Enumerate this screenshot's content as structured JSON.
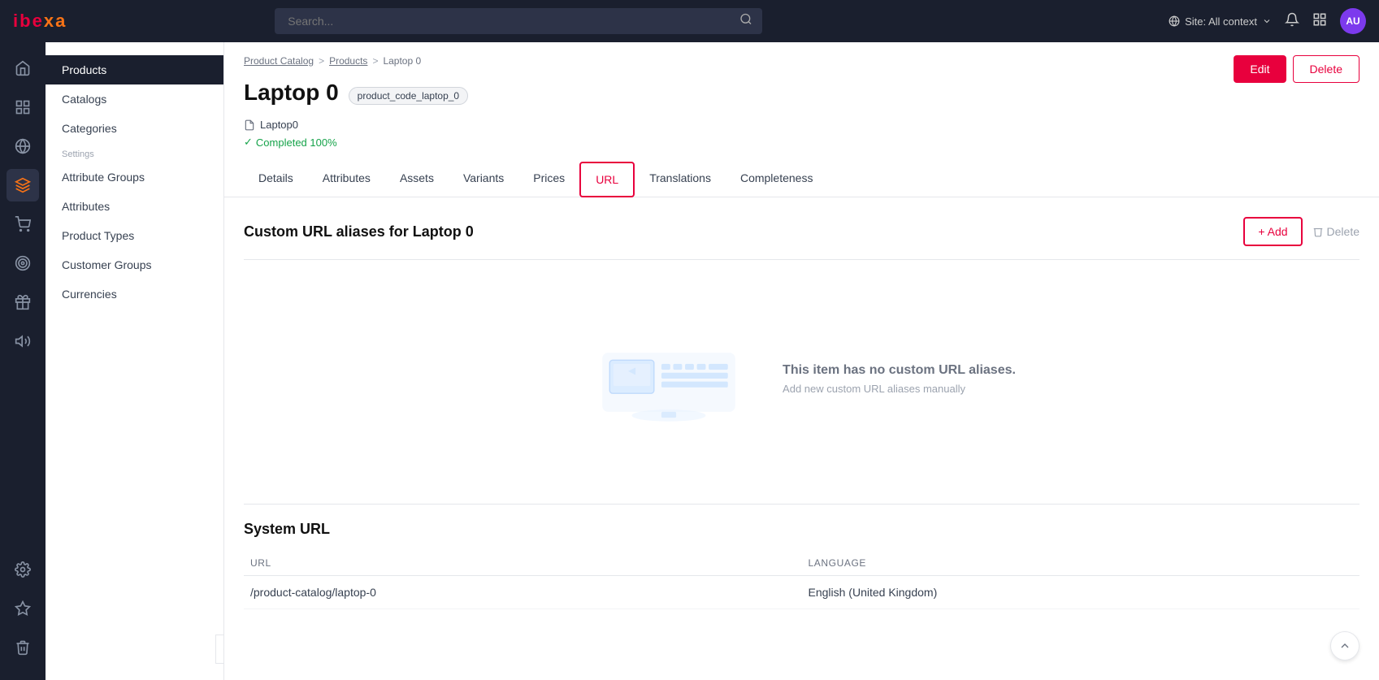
{
  "topbar": {
    "logo": "ibexa",
    "search_placeholder": "Search...",
    "site_context": "Site: All context",
    "avatar_initials": "AU"
  },
  "breadcrumb": {
    "items": [
      "Product Catalog",
      "Products",
      "Laptop 0"
    ],
    "separators": [
      ">",
      ">"
    ]
  },
  "page": {
    "title": "Laptop 0",
    "product_code": "product_code_laptop_0",
    "path_icon": "📄",
    "path_text": "Laptop0",
    "completion_text": "Completed 100%",
    "edit_label": "Edit",
    "delete_label": "Delete"
  },
  "tabs": [
    {
      "label": "Details",
      "active": false
    },
    {
      "label": "Attributes",
      "active": false
    },
    {
      "label": "Assets",
      "active": false
    },
    {
      "label": "Variants",
      "active": false
    },
    {
      "label": "Prices",
      "active": false
    },
    {
      "label": "URL",
      "active": true
    },
    {
      "label": "Translations",
      "active": false
    },
    {
      "label": "Completeness",
      "active": false
    }
  ],
  "url_tab": {
    "custom_url_section_title": "Custom URL aliases for Laptop 0",
    "add_label": "+ Add",
    "delete_label": "Delete",
    "empty_title": "This item has no custom URL aliases.",
    "empty_subtitle": "Add new custom URL aliases manually",
    "system_url_title": "System URL",
    "table_headers": {
      "url": "URL",
      "language": "Language"
    },
    "system_urls": [
      {
        "url": "/product-catalog/laptop-0",
        "language": "English (United Kingdom)"
      }
    ]
  },
  "sidebar": {
    "items": [
      {
        "label": "Products",
        "active": true
      },
      {
        "label": "Catalogs",
        "active": false
      },
      {
        "label": "Categories",
        "active": false
      }
    ],
    "settings_label": "Settings",
    "settings_items": [
      {
        "label": "Attribute Groups",
        "active": false
      },
      {
        "label": "Attributes",
        "active": false
      },
      {
        "label": "Product Types",
        "active": false
      },
      {
        "label": "Customer Groups",
        "active": false
      },
      {
        "label": "Currencies",
        "active": false
      }
    ]
  },
  "nav_icons": [
    {
      "name": "home-icon",
      "symbol": "⌂"
    },
    {
      "name": "grid-icon",
      "symbol": "⊞"
    },
    {
      "name": "globe-icon",
      "symbol": "🌐"
    },
    {
      "name": "products-icon",
      "symbol": "◈"
    },
    {
      "name": "cart-icon",
      "symbol": "🛒"
    },
    {
      "name": "target-icon",
      "symbol": "◎"
    },
    {
      "name": "stamp-icon",
      "symbol": "⊟"
    },
    {
      "name": "megaphone-icon",
      "symbol": "📣"
    }
  ],
  "nav_bottom_icons": [
    {
      "name": "settings-icon",
      "symbol": "⚙"
    },
    {
      "name": "star-icon",
      "symbol": "★"
    },
    {
      "name": "trash-icon",
      "symbol": "🗑"
    }
  ]
}
